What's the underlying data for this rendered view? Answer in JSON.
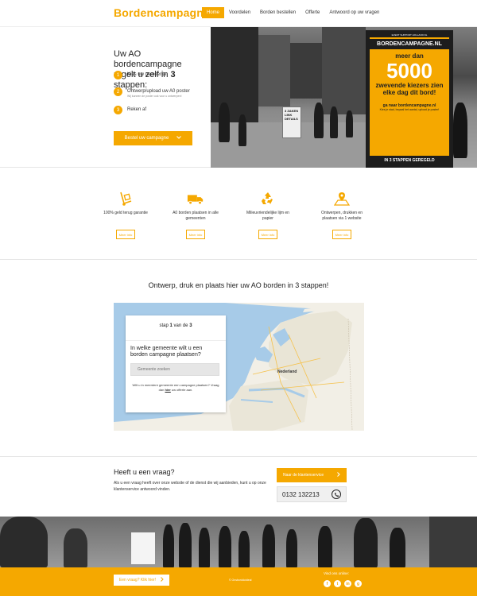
{
  "header": {
    "logo": "Bordencampagne.nl",
    "nav": [
      {
        "label": "Home",
        "active": true
      },
      {
        "label": "Voordelen",
        "active": false
      },
      {
        "label": "Borden bestellen",
        "active": false
      },
      {
        "label": "Offerte",
        "active": false
      },
      {
        "label": "Antwoord op uw vragen",
        "active": false
      }
    ]
  },
  "hero": {
    "title_line1": "Uw AO bordencampagne",
    "title_line2_pre": "regelt u zelf in ",
    "title_line2_num": "3",
    "title_line2_post": " stappen:",
    "steps": [
      {
        "num": "1",
        "text": "Kies uw gemeente",
        "sub": ""
      },
      {
        "num": "2",
        "text": "Ontwerp/upload uw A0 poster",
        "sub": "Wij kunnen de poster ook voor u ontwerpen!"
      },
      {
        "num": "3",
        "text": "Reken af",
        "sub": ""
      }
    ],
    "order_button": "Bestel uw campagne",
    "sign": {
      "top": "EVENT SUPPORT HOLLAND.NL",
      "head": "BORDENCAMPAGNE.NL",
      "line1": "meer dan",
      "big": "5000",
      "line2": "zwevende kiezers zien elke dag dit bord!",
      "foot1": "ga naar bordencampagne.nl",
      "foot2": "Kies je stad, bepaal het aantal, upload je poster!",
      "bottom": "IN 3 STAPPEN GEREGELD"
    },
    "stand_text": "3 ZAKEN LINK DETAILS"
  },
  "features": [
    {
      "icon": "hand-truck-icon",
      "text": "100% geld terug garantie",
      "button": "Meer info"
    },
    {
      "icon": "delivery-truck-icon",
      "text": "A0 borden plaatsen in alle gemeenten",
      "button": "Meer info"
    },
    {
      "icon": "recycle-icon",
      "text": "Milieuvriendelijke lijm en papier",
      "button": "Meer info"
    },
    {
      "icon": "map-pin-icon",
      "text": "Ontwerpen, drukken en plaatsen via 1 website",
      "button": "Meer info"
    }
  ],
  "map_section": {
    "heading": "Ontwerp, druk en plaats hier uw AO borden in 3 stappen!",
    "card": {
      "step_pre": "stap ",
      "step_num": "1",
      "step_post": " van de ",
      "step_total": "3",
      "question": "In welke gemeente wilt u een borden campagne plaatsen?",
      "input_placeholder": "Gemeente zoeken",
      "note_pre": "Wilt u in meerdere gemeente een campagne plaatsen? Vraag dan ",
      "note_link": "hier",
      "note_post": " uw offerte aan."
    },
    "map_label": "Nederland"
  },
  "question": {
    "title": "Heeft u een vraag?",
    "text": "Als u een vraag heeft over onze website of de dienst die wij aanbieden, kunt u op onze klantenservice antwoord vinden.",
    "button": "Naar de klantenservice",
    "phone": "0132 132213"
  },
  "footer": {
    "button": "Een vraag? Klik hier!",
    "copyright": "© Onsborddotdeal",
    "social_label": "Vind ons online:",
    "social": [
      "facebook-icon",
      "twitter-icon",
      "linkedin-icon",
      "googleplus-icon"
    ]
  },
  "colors": {
    "accent": "#f5a800",
    "map_water": "#a7cbe8",
    "map_land": "#f2efe6"
  }
}
